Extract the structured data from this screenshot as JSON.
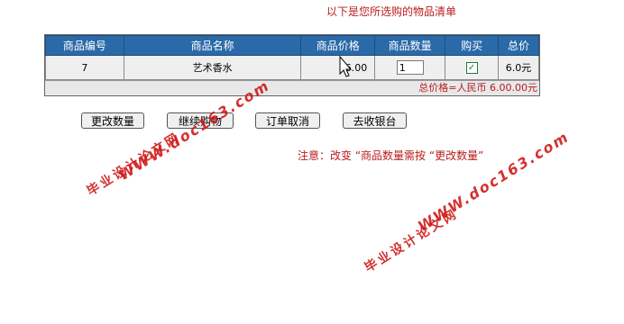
{
  "heading": "以下是您所选购的物品清单",
  "table": {
    "headers": [
      "商品编号",
      "商品名称",
      "商品价格",
      "商品数量",
      "购买",
      "总价"
    ],
    "rows": [
      {
        "id": "7",
        "name": "艺术香水",
        "price": "6.00",
        "qty": "1",
        "checked": true,
        "total": "6.0元"
      }
    ],
    "grand_total": "总价格=人民币 6.00.00元"
  },
  "buttons": {
    "update": "更改数量",
    "continue": "继续购物",
    "cancel": "订单取消",
    "checkout": "去收银台"
  },
  "note": "注意：改变 “商品数量需按 “更改数量”",
  "watermarks": {
    "site_cn": "毕业设计论文网",
    "site_url": "WWW.doc163.com"
  },
  "colors": {
    "header_bg": "#2a6aa8",
    "accent_red": "#b81c1c"
  }
}
